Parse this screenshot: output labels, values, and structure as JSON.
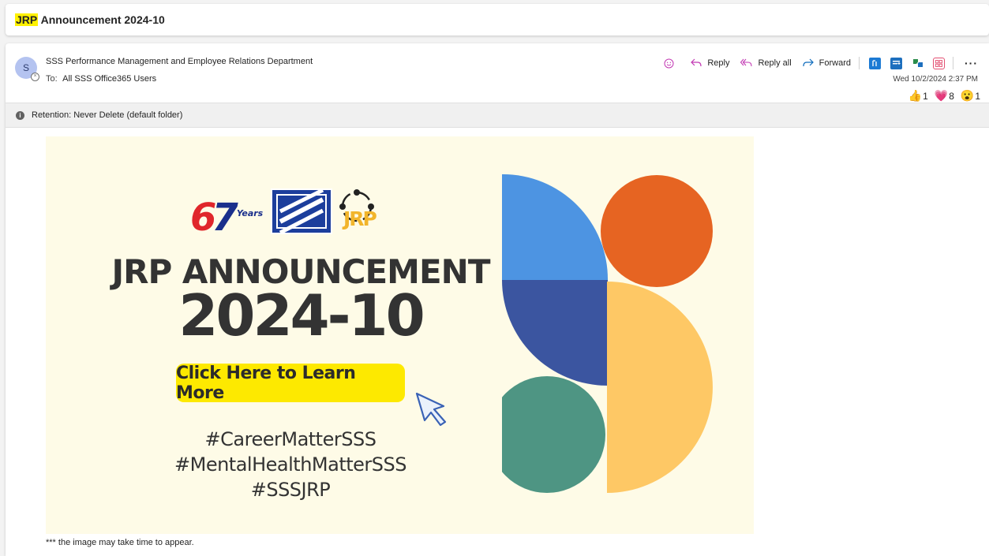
{
  "subject": {
    "highlight": "JRP",
    "rest": " Announcement 2024-10"
  },
  "message": {
    "avatar_initial": "S",
    "sender": "SSS Performance Management and Employee Relations Department",
    "to_label": "To:",
    "to_value": "All SSS Office365 Users",
    "date": "Wed 10/2/2024 2:37 PM",
    "actions": {
      "reply": "Reply",
      "reply_all": "Reply all",
      "forward": "Forward",
      "more": "···"
    },
    "reactions": [
      {
        "icon": "thumbs-up",
        "emoji": "👍",
        "count": "1"
      },
      {
        "icon": "heart",
        "emoji": "💗",
        "count": "8"
      },
      {
        "icon": "surprised-face",
        "emoji": "😮",
        "count": "1"
      }
    ],
    "retention": "Retention: Never Delete (default folder)"
  },
  "banner": {
    "logo_67": "67",
    "logo_years": "Years",
    "logo_jrp": "JRP",
    "title_line1": "JRP ANNOUNCEMENT",
    "title_line2": "2024-10",
    "cta": "Click Here to Learn More",
    "hashtags": [
      "#CareerMatterSSS",
      "#MentalHealthMatterSSS",
      "#SSSJRP"
    ],
    "colors": {
      "background": "#fefbe7",
      "blue_light": "#4d94e2",
      "blue_dark": "#3b55a0",
      "orange": "#e66422",
      "yellow": "#fec865",
      "green": "#4e9583",
      "cta": "#fde900"
    }
  },
  "footnote": "*** the image may take time to appear."
}
